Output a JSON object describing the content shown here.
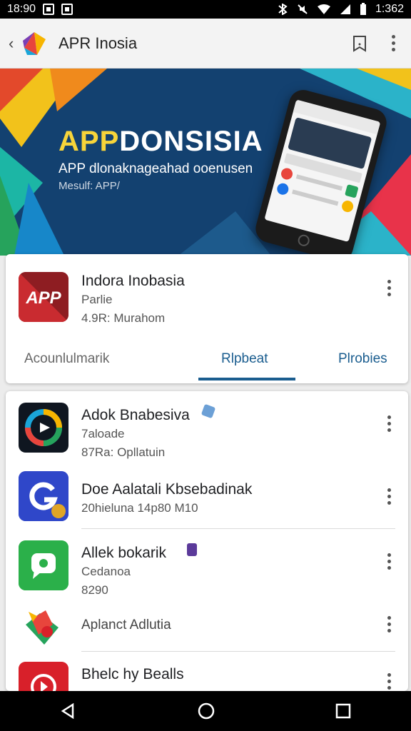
{
  "status_bar": {
    "time_left": "18:90",
    "time_right": "1:362"
  },
  "app_bar": {
    "title": "APR Inosia",
    "bookmark_icon": "bookmark-icon",
    "more_icon": "more-vert-icon"
  },
  "banner": {
    "title_highlight": "APP",
    "title_rest": "DONSISIA",
    "subtitle": "APP dlonaknageahad ooenusen",
    "tagline": "Mesulf: APP/"
  },
  "featured_app": {
    "name": "Indora Inobasia",
    "category": "Parlie",
    "meta": "4.9R: Murahom",
    "icon_text": "APP",
    "tabs": [
      {
        "label": "Acounlulmarik",
        "active": false
      },
      {
        "label": "Rlpbeat",
        "active": true
      },
      {
        "label": "Plrobies",
        "active": false
      }
    ]
  },
  "app_list": [
    {
      "name": "Adok Bnabesiva",
      "line2": "7aloade",
      "line3": "87Ra: Opllatuin",
      "icon": "drive-icon"
    },
    {
      "name": "Doe Aalatali Kbsebadinak",
      "line2": "20hieluna 14p80 M10",
      "line3": "",
      "icon": "g-icon"
    },
    {
      "name": "Allek bokarik",
      "line2": "Cedanoa",
      "line3": "8290",
      "icon": "chat-icon"
    },
    {
      "name": "Aplanct Adlutia",
      "line2": "",
      "line3": "",
      "icon": "puzzle-icon"
    },
    {
      "name": "Bhelc hy Bealls",
      "line2": "",
      "line3": "",
      "icon": "play-icon"
    }
  ],
  "colors": {
    "accent": "#1a5d8f",
    "banner_bg": "#14406a",
    "card_bg": "#ffffff"
  }
}
